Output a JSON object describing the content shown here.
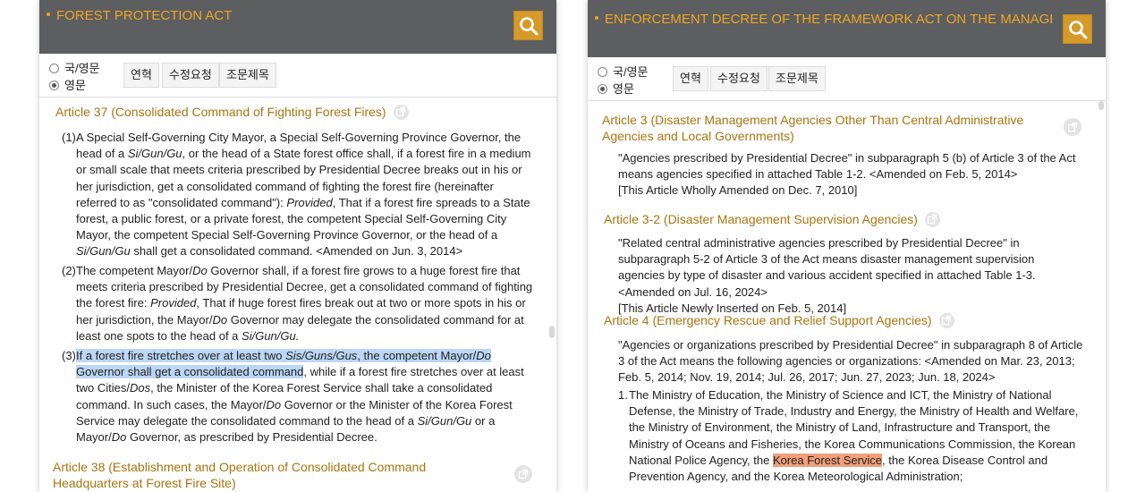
{
  "left": {
    "title": "FOREST PROTECTION ACT",
    "radio_options": [
      "국/영문",
      "영문"
    ],
    "selected_radio": "영문",
    "buttons": [
      "연혁",
      "수정요청",
      "조문제목"
    ],
    "article37_title": "Article 37 (Consolidated Command of Fighting Forest Fires)",
    "p1_num": "(1)",
    "p1": {
      "a": "A Special Self-Governing City Mayor, a Special Self-Governing Province Governor, the head of a",
      "sgg": "Si/Gun/Gu",
      "b": ", or the head of a State forest office shall, if a forest fire in a medium or small scale that meets criteria prescribed by Presidential Decree breaks out in his or her jurisdiction, get a consolidated command of fighting the forest fire (hereinafter referred to as \"consolidated command\"):",
      "provided": "Provided",
      "c": ", That if a forest fire spreads to a State forest, a public forest, or a private forest, the competent Special Self-Governing City Mayor, the competent Special Self-Governing Province Governor, or the head of a",
      "d": "shall get a consolidated command. <Amended on Jun. 3, 2014>"
    },
    "p2_num": "(2)",
    "p2": {
      "a": "The competent Mayor/",
      "do": "Do",
      "b": "Governor shall, if a forest fire grows to a huge forest fire that meets criteria prescribed by Presidential Decree, get a consolidated command of fighting the forest fire:",
      "provided": "Provided",
      "c": ", That if huge forest fires break out at two or more spots in his or her jurisdiction, the Mayor/",
      "d": "Governor may delegate the consolidated command for at least one spots to the head of a",
      "sgg": "Si/Gun/Gu."
    },
    "p3_num": "(3)",
    "p3": {
      "hl1": "If a forest fire stretches over at least two",
      "sgg_plural": "Sis/Guns/Gus",
      "hl2": ", the competent Mayor/",
      "do": "Do",
      "hl3": "Governor shall get a consolidated command",
      "a": ", while if a forest fire stretches over at least two Cities/",
      "dos": "Dos",
      "b": ", the Minister of the Korea Forest Service shall take a consolidated command. In such cases, the Mayor/",
      "c": "Governor or the Minister of the Korea Forest Service may delegate the consolidated command to the head of a",
      "sgg": "Si/Gun/Gu",
      "d": "or a Mayor/",
      "e": "Governor, as prescribed by Presidential Decree."
    },
    "article38_title": "Article 38 (Establishment and Operation of Consolidated Command Headquarters at Forest Fire Site)"
  },
  "right": {
    "title": "ENFORCEMENT DECREE OF THE FRAMEWORK ACT ON THE MANAGEMENT OF DI",
    "radio_options": [
      "국/영문",
      "영문"
    ],
    "selected_radio": "영문",
    "buttons": [
      "연혁",
      "수정요청",
      "조문제목"
    ],
    "article3_title": "Article 3 (Disaster Management Agencies Other Than Central Administrative Agencies and Local Governments)",
    "article3_body": "\"Agencies prescribed by Presidential Decree\" in subparagraph 5 (b) of Article 3 of the Act means agencies specified in attached Table 1-2. <Amended on Feb. 5, 2014>",
    "article3_note": "[This Article Wholly Amended on Dec. 7, 2010]",
    "article32_title": "Article 3-2 (Disaster Management Supervision Agencies)",
    "article32_body": "\"Related central administrative agencies prescribed by Presidential Decree\" in subparagraph 5-2 of Article 3 of the Act means disaster management supervision agencies by type of disaster and various accident specified in attached Table 1-3. <Amended on Jul. 16, 2024>",
    "article32_note": "[This Article Newly Inserted on Feb. 5, 2014]",
    "article4_title": "Article 4 (Emergency Rescue and Relief Support Agencies)",
    "article4_body": "\"Agencies or organizations prescribed by Presidential Decree\" in subparagraph 8 of Article 3 of the Act means the following agencies or organizations: <Amended on Mar. 23, 2013; Feb. 5, 2014; Nov. 19, 2014; Jul. 26, 2017; Jun. 27, 2023; Jun. 18, 2024>",
    "item1_num": "1.",
    "item1_a": "The Ministry of Education, the Ministry of Science and ICT, the Ministry of National Defense, the Ministry of Trade, Industry and Energy, the Ministry of Health and Welfare, the Ministry of Environment, the Ministry of Land, Infrastructure and Transport, the Ministry of Oceans and Fisheries, the Korea Communications Commission, the Korean National Police Agency, the",
    "item1_hl": "Korea Forest Service",
    "item1_b": ", the Korea Disease Control and Prevention Agency, and the Korea Meteorological Administration;"
  },
  "colors": {
    "header_bg": "#5c5e60",
    "title_color": "#f0a623",
    "search_button": "#d59a2a",
    "article_title": "#a9740f",
    "selection_highlight": "#bcd6f5",
    "search_highlight": "#f0a07a"
  },
  "icons": [
    "search-icon",
    "external-link-icon",
    "radio-icon"
  ]
}
